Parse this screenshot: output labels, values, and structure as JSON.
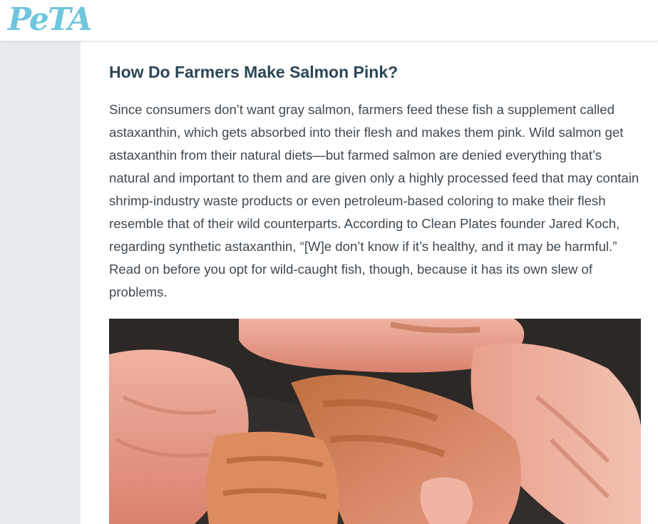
{
  "header": {
    "logo_text": "PeTA",
    "logo_color": "#6fc6dc"
  },
  "article": {
    "title": "How Do Farmers Make Salmon Pink?",
    "paragraph": "Since consumers don’t want gray salmon, farmers feed these fish a supplement called astaxanthin, which gets absorbed into their flesh and makes them pink. Wild salmon get astaxanthin from their natural diets—but farmed salmon are denied everything that’s natural and important to them and are given only a highly processed feed that may contain shrimp-industry waste products or even petroleum-based coloring to make their flesh resemble that of their wild counterparts. According to Clean Plates founder Jared Koch, regarding synthetic astaxanthin, “[W]e don’t know if it’s healthy, and it may be harmful.” Read on before you opt for wild-caught fish, though, because it has its own slew of problems.",
    "title_color": "#2b4657",
    "text_color": "#404a52"
  },
  "photo": {
    "subject": "cooked salmon fillets in a pan",
    "colors": {
      "pan": "#2c2826",
      "flesh": "#e79a86",
      "flesh_light": "#f2b7a6",
      "seared": "#b9673d"
    }
  },
  "sidebar": {
    "color": "#e5ebee"
  }
}
